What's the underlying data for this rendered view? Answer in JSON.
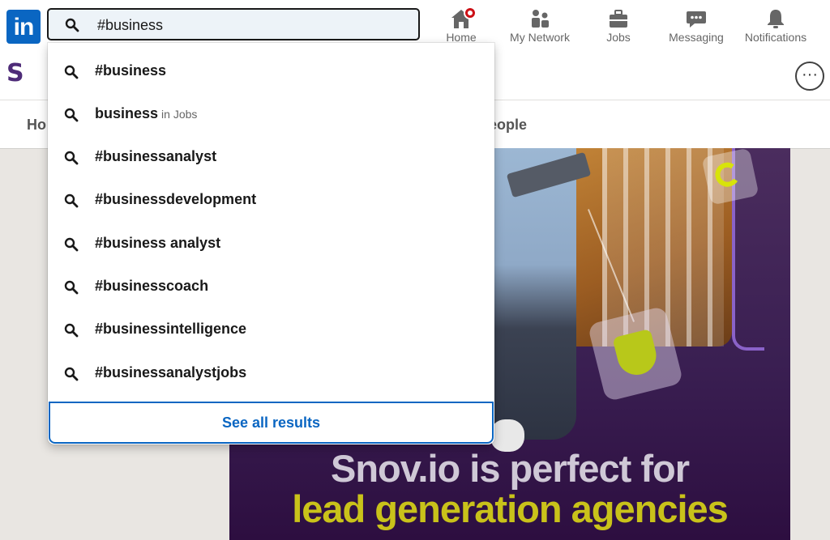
{
  "topbar": {
    "logo_text": "in",
    "search_value": "#business",
    "nav": [
      {
        "label": "Home",
        "icon": "home-icon"
      },
      {
        "label": "My Network",
        "icon": "network-icon"
      },
      {
        "label": "Jobs",
        "icon": "briefcase-icon"
      },
      {
        "label": "Messaging",
        "icon": "chat-icon"
      },
      {
        "label": "Notifications",
        "icon": "bell-icon"
      }
    ]
  },
  "page": {
    "company_initial": "S",
    "more_label": "···",
    "tabs": [
      {
        "label": "Ho"
      },
      {
        "label": "eople"
      }
    ]
  },
  "ad": {
    "headline_line1": "Snov.io is perfect for",
    "headline_line2": "lead generation agencies"
  },
  "dropdown": {
    "suggestions": [
      {
        "text": "#business",
        "sub": ""
      },
      {
        "text": "business",
        "sub": "in Jobs"
      },
      {
        "text": "#businessanalyst",
        "sub": ""
      },
      {
        "text": "#businessdevelopment",
        "sub": ""
      },
      {
        "text": "#business analyst",
        "sub": ""
      },
      {
        "text": "#businesscoach",
        "sub": ""
      },
      {
        "text": "#businessintelligence",
        "sub": ""
      },
      {
        "text": "#businessanalystjobs",
        "sub": ""
      }
    ],
    "see_all_label": "See all results"
  },
  "colors": {
    "brand": "#0a66c2",
    "badge": "#cc1016",
    "ad_yellow": "#c9c21a"
  }
}
